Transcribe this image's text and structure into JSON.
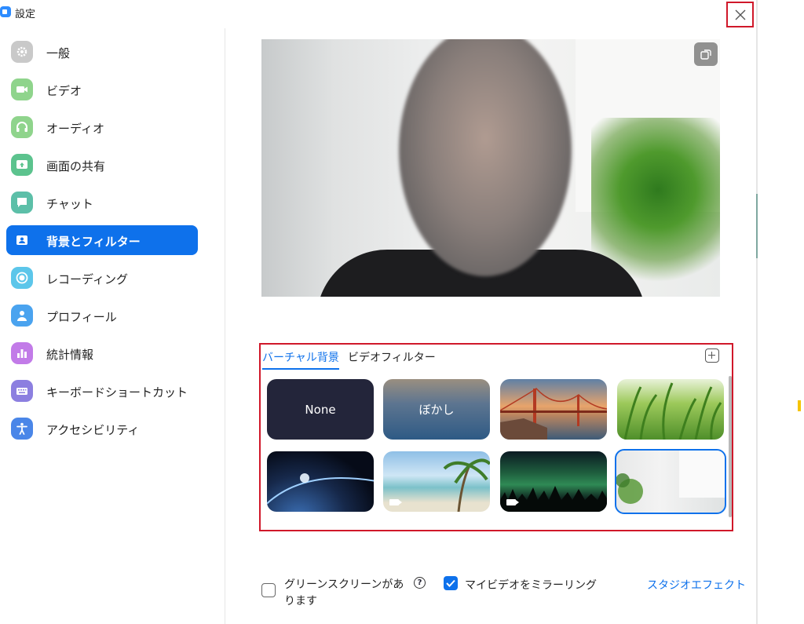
{
  "window": {
    "title": "設定"
  },
  "sidebar": {
    "items": [
      {
        "label": "一般",
        "icon": "gear-icon",
        "color": "#c9c9c9",
        "active": false
      },
      {
        "label": "ビデオ",
        "icon": "video-camera-icon",
        "color": "#8fd48c",
        "active": false
      },
      {
        "label": "オーディオ",
        "icon": "headphones-icon",
        "color": "#8fd48c",
        "active": false
      },
      {
        "label": "画面の共有",
        "icon": "share-screen-icon",
        "color": "#5cc38e",
        "active": false
      },
      {
        "label": "チャット",
        "icon": "chat-bubble-icon",
        "color": "#5cbfa8",
        "active": false
      },
      {
        "label": "背景とフィルター",
        "icon": "portrait-icon",
        "color": "#0e71eb",
        "active": true
      },
      {
        "label": "レコーディング",
        "icon": "record-icon",
        "color": "#5cc6ea",
        "active": false
      },
      {
        "label": "プロフィール",
        "icon": "person-icon",
        "color": "#4aa3ef",
        "active": false
      },
      {
        "label": "統計情報",
        "icon": "bar-chart-icon",
        "color": "#c27be8",
        "active": false
      },
      {
        "label": "キーボードショートカット",
        "icon": "keyboard-icon",
        "color": "#8c7fe0",
        "active": false
      },
      {
        "label": "アクセシビリティ",
        "icon": "accessibility-icon",
        "color": "#4a86e8",
        "active": false
      }
    ]
  },
  "background": {
    "tabs": {
      "virtual": "バーチャル背景",
      "filters": "ビデオフィルター"
    },
    "thumbnails": [
      {
        "label": "None",
        "kind": "none"
      },
      {
        "label": "ぼかし",
        "kind": "blur"
      },
      {
        "label": "",
        "kind": "golden-gate-bridge"
      },
      {
        "label": "",
        "kind": "grass"
      },
      {
        "label": "",
        "kind": "earth-from-space"
      },
      {
        "label": "",
        "kind": "beach-palm",
        "video": true
      },
      {
        "label": "",
        "kind": "aurora",
        "video": true
      },
      {
        "label": "",
        "kind": "office-plant",
        "selected": true
      }
    ]
  },
  "footer": {
    "green_screen_label": "グリーンスクリーンがあります",
    "green_screen_checked": false,
    "help_glyph": "?",
    "mirror_label": "マイビデオをミラーリング",
    "mirror_checked": true,
    "studio_effects": "スタジオエフェクト"
  },
  "colors": {
    "accent": "#0e71eb",
    "highlight_box": "#d0182a"
  }
}
